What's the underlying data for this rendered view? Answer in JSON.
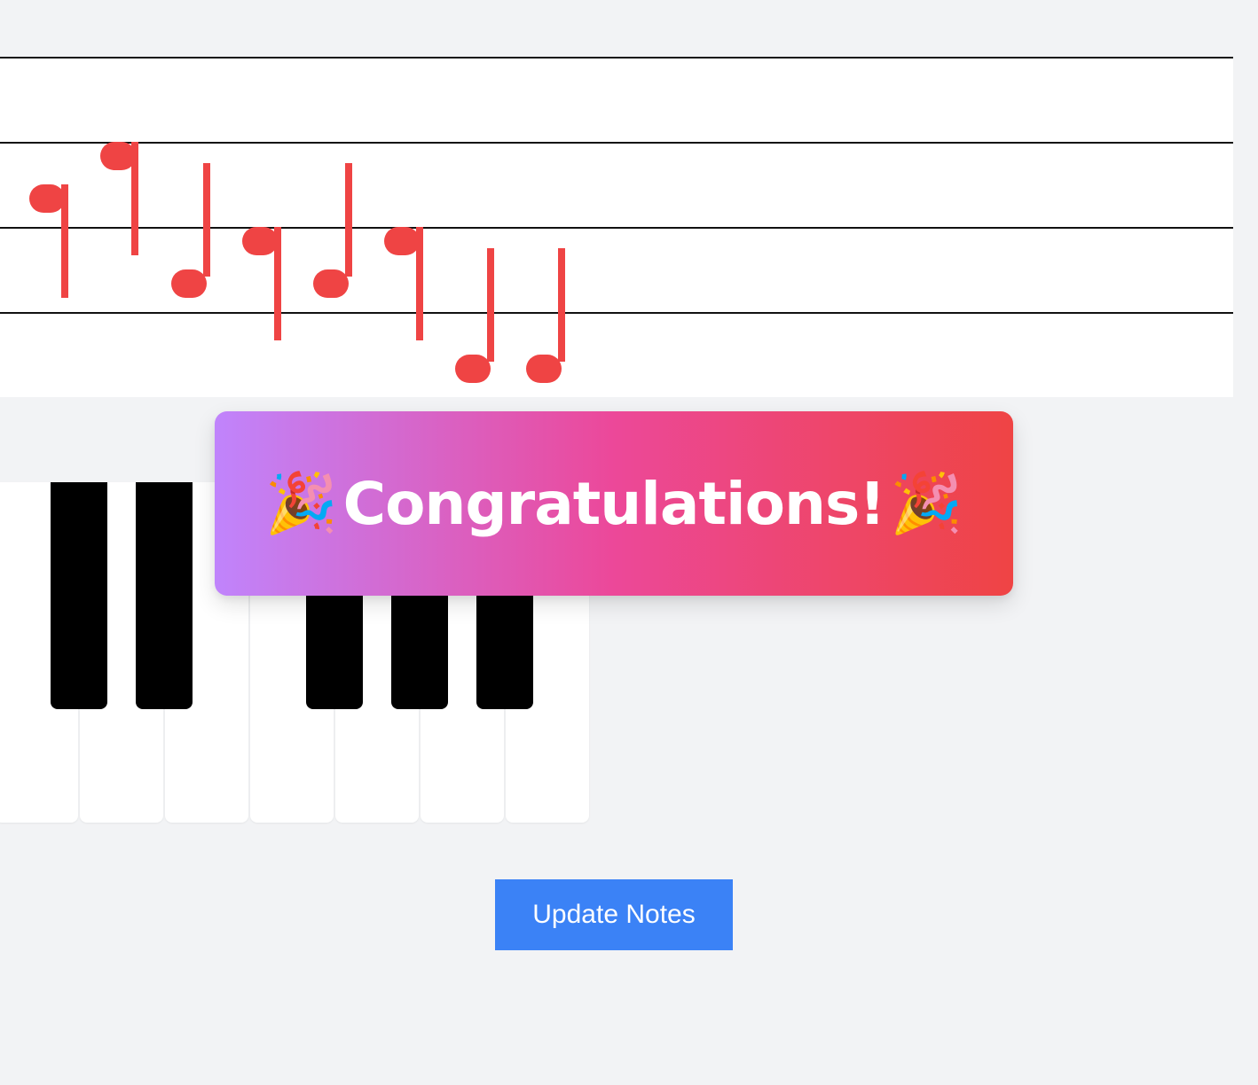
{
  "staff": {
    "line_count": 4,
    "note_color": "#ef4444",
    "notes": [
      {
        "index": 0,
        "stem": "down"
      },
      {
        "index": 1,
        "stem": "down"
      },
      {
        "index": 2,
        "stem": "up"
      },
      {
        "index": 3,
        "stem": "down"
      },
      {
        "index": 4,
        "stem": "up"
      },
      {
        "index": 5,
        "stem": "down"
      },
      {
        "index": 6,
        "stem": "up"
      },
      {
        "index": 7,
        "stem": "up"
      }
    ]
  },
  "keyboard": {
    "white_key_color": "#ffffff",
    "black_key_color": "#000000"
  },
  "banner": {
    "text": "Congratulations!",
    "emoji_left": "🎉",
    "emoji_right": "🎉",
    "gradient": [
      "#c084fc",
      "#ec4899",
      "#ef4444"
    ]
  },
  "actions": {
    "update_label": "Update Notes",
    "button_color": "#3b82f6"
  }
}
